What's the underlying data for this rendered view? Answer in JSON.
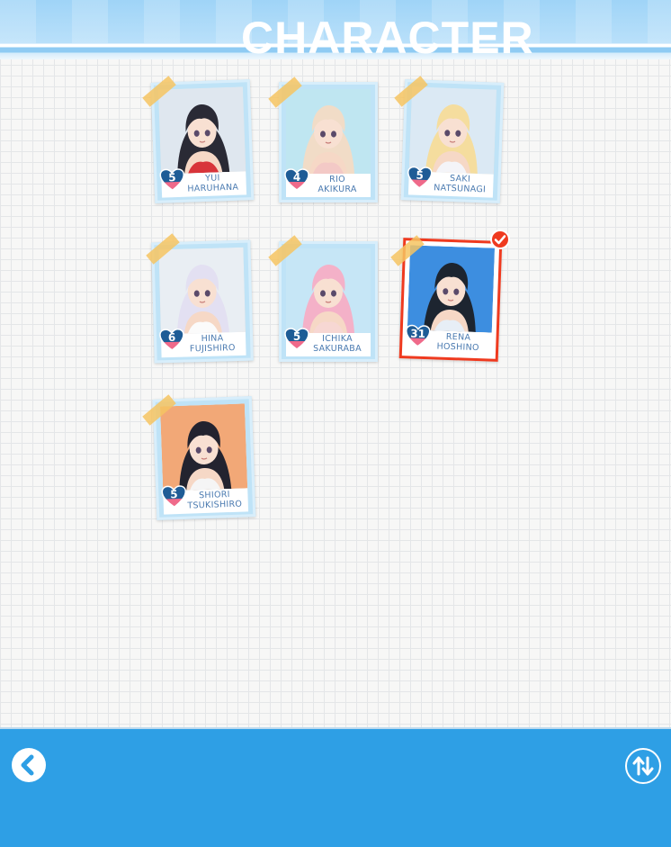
{
  "header": {
    "title": "CHARACTER"
  },
  "characters": [
    {
      "first_name": "YUI",
      "last_name": "HARUHANA",
      "level": "5",
      "selected": false,
      "hair_color": "#2a2a35",
      "bg_color": "#dfe7ef",
      "outfit_color": "#d8343a"
    },
    {
      "first_name": "RIO",
      "last_name": "AKIKURA",
      "level": "4",
      "selected": false,
      "hair_color": "#f1dcc7",
      "bg_color": "#bfe6f1",
      "outfit_color": "#f3c9c6"
    },
    {
      "first_name": "SAKI",
      "last_name": "NATSUNAGI",
      "level": "5",
      "selected": false,
      "hair_color": "#f5dd9e",
      "bg_color": "#dbe9f4",
      "outfit_color": "#f4f4f8"
    },
    {
      "first_name": "HINA",
      "last_name": "FUJISHIRO",
      "level": "6",
      "selected": false,
      "hair_color": "#e3e0f2",
      "bg_color": "#e9eef3",
      "outfit_color": "#fbfbfb"
    },
    {
      "first_name": "ICHIKA",
      "last_name": "SAKURABA",
      "level": "5",
      "selected": false,
      "hair_color": "#f4b1c8",
      "bg_color": "#c6e6f6",
      "outfit_color": "#f7d7d3"
    },
    {
      "first_name": "RENA",
      "last_name": "HOSHINO",
      "level": "31",
      "selected": true,
      "hair_color": "#1d2530",
      "bg_color": "#3d8ee0",
      "outfit_color": "#e7eef6"
    },
    {
      "first_name": "SHIORI",
      "last_name": "TSUKISHIRO",
      "level": "5",
      "selected": false,
      "hair_color": "#23232f",
      "bg_color": "#f2a877",
      "outfit_color": "#f5f5f5"
    }
  ],
  "footer": {
    "back_icon": "chevron-left-icon",
    "sort_icon": "sort-arrows-icon"
  },
  "colors": {
    "accent_blue": "#2e9fe5",
    "selection_red": "#ef3a1f",
    "name_text": "#4a7ab0",
    "heart_blue": "#1e5c96",
    "heart_pink": "#ef6a8a"
  }
}
